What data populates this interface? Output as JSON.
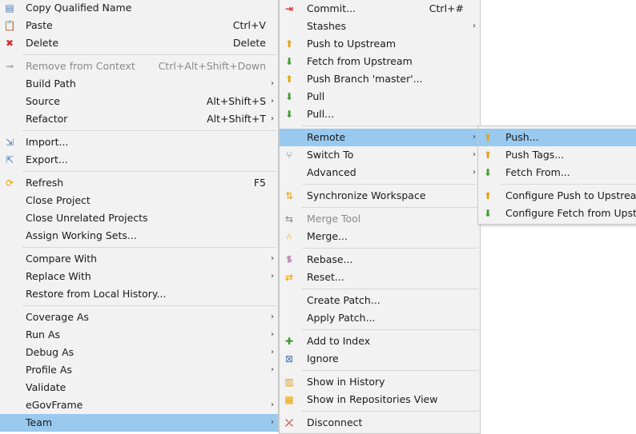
{
  "menu1": {
    "copy_qualified_name": "Copy Qualified Name",
    "paste": "Paste",
    "paste_sc": "Ctrl+V",
    "delete": "Delete",
    "delete_sc": "Delete",
    "remove_from_context": "Remove from Context",
    "remove_from_context_sc": "Ctrl+Alt+Shift+Down",
    "build_path": "Build Path",
    "source": "Source",
    "source_sc": "Alt+Shift+S",
    "refactor": "Refactor",
    "refactor_sc": "Alt+Shift+T",
    "import": "Import...",
    "export": "Export...",
    "refresh": "Refresh",
    "refresh_sc": "F5",
    "close_project": "Close Project",
    "close_unrelated_projects": "Close Unrelated Projects",
    "assign_working_sets": "Assign Working Sets...",
    "compare_with": "Compare With",
    "replace_with": "Replace With",
    "restore_local_history": "Restore from Local History...",
    "coverage_as": "Coverage As",
    "run_as": "Run As",
    "debug_as": "Debug As",
    "profile_as": "Profile As",
    "validate": "Validate",
    "egovframe": "eGovFrame",
    "team": "Team"
  },
  "menu2": {
    "commit": "Commit...",
    "commit_sc": "Ctrl+#",
    "stashes": "Stashes",
    "push_upstream": "Push to Upstream",
    "fetch_upstream": "Fetch from Upstream",
    "push_branch": "Push Branch 'master'...",
    "pull": "Pull",
    "pull_dots": "Pull...",
    "remote": "Remote",
    "switch_to": "Switch To",
    "advanced": "Advanced",
    "sync_workspace": "Synchronize Workspace",
    "merge_tool": "Merge Tool",
    "merge": "Merge...",
    "rebase": "Rebase...",
    "reset": "Reset...",
    "create_patch": "Create Patch...",
    "apply_patch": "Apply Patch...",
    "add_to_index": "Add to Index",
    "ignore": "Ignore",
    "show_history": "Show in History",
    "show_repos": "Show in Repositories View",
    "disconnect": "Disconnect"
  },
  "menu3": {
    "push": "Push...",
    "push_tags": "Push Tags...",
    "fetch_from": "Fetch From...",
    "configure_push": "Configure Push to Upstream...",
    "configure_fetch": "Configure Fetch from Upstream..."
  },
  "colors": {
    "menu_bg": "#f2f2f2",
    "selection": "#99c9ef",
    "disabled_text": "#8a8a8a"
  }
}
